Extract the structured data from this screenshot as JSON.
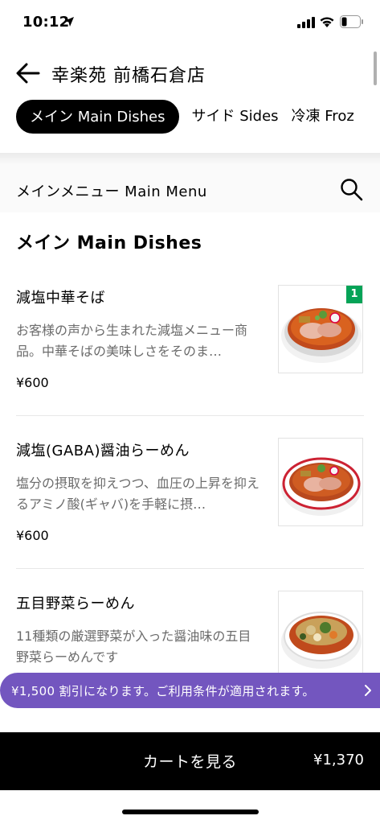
{
  "status_bar": {
    "time": "10:12",
    "icons": [
      "location-arrow-icon",
      "cellular-signal-icon",
      "wifi-icon",
      "battery-icon"
    ]
  },
  "header": {
    "back_icon": "arrow-left-icon",
    "store_name": "幸楽苑 前橋石倉店"
  },
  "category_tabs": [
    {
      "label": "メイン Main Dishes",
      "active": true
    },
    {
      "label": "サイド Sides",
      "active": false
    },
    {
      "label": "冷凍 Froz",
      "active": false
    }
  ],
  "menu": {
    "title": "メインメニュー Main Menu",
    "search_icon": "search-icon"
  },
  "section": {
    "title": "メイン Main Dishes"
  },
  "items": [
    {
      "name": "減塩中華そば",
      "description": "お客様の声から生まれた減塩メニュー商品。中華そばの美味しさをそのま…",
      "price": "¥600",
      "quantity_badge": "1",
      "image": "ramen-chashu-bowl"
    },
    {
      "name": "減塩(GABA)醤油らーめん",
      "description": "塩分の摂取を抑えつつ、血圧の上昇を抑えるアミノ酸(ギャバ)を手軽に摂…",
      "price": "¥600",
      "image": "shoyu-ramen-bowl"
    },
    {
      "name": "五目野菜らーめん",
      "description": "11種類の厳選野菜が入った醤油味の五目野菜らーめんです",
      "price": "",
      "image": "vegetable-ramen-bowl"
    }
  ],
  "promo": {
    "text": "¥1,500 割引になります。ご利用条件が適用されます。",
    "icon": "chevron-right-icon",
    "color": "#7356bf"
  },
  "cart": {
    "label": "カートを見る",
    "total": "¥1,370"
  },
  "colors": {
    "badge_green": "#05a357",
    "cart_bar": "#000000"
  }
}
